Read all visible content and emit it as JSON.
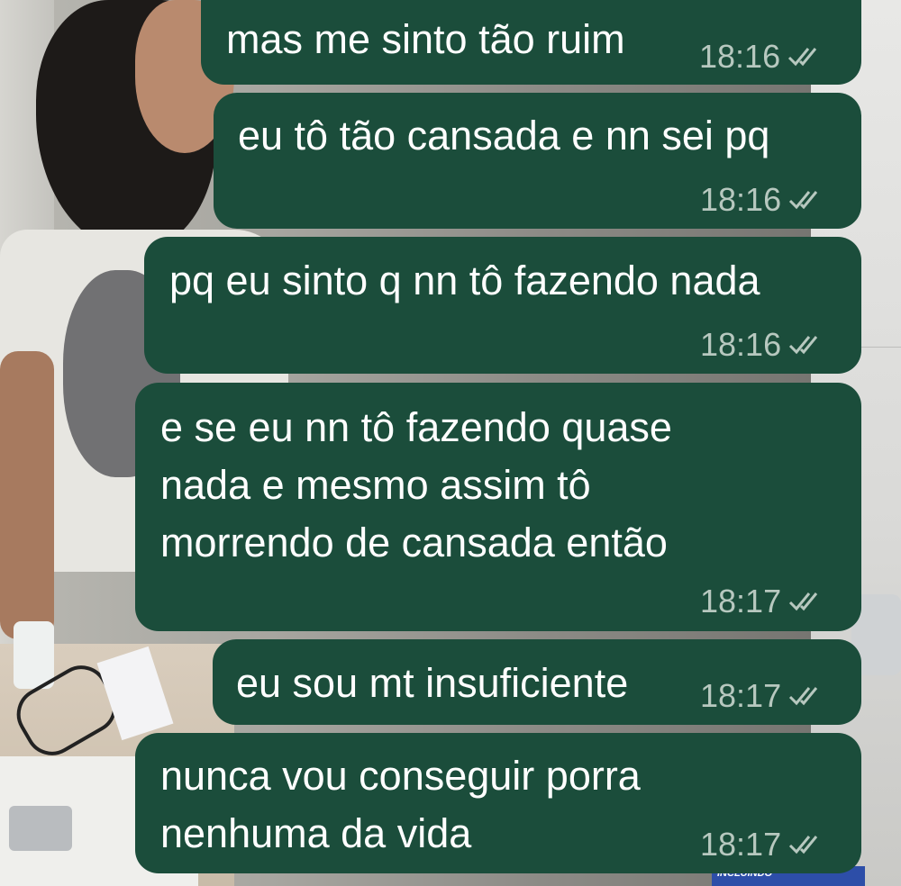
{
  "chat": {
    "messages": [
      {
        "text": "mas me sinto tão ruim",
        "time": "18:16",
        "status_icon": "double-check-icon"
      },
      {
        "text": "eu tô tão cansada e nn sei pq",
        "time": "18:16",
        "status_icon": "double-check-icon"
      },
      {
        "text": "pq eu sinto q nn tô fazendo nada",
        "time": "18:16",
        "status_icon": "double-check-icon"
      },
      {
        "text": "e se eu nn tô fazendo quase\nnada e mesmo assim tô\nmorrendo de cansada então",
        "time": "18:17",
        "status_icon": "double-check-icon"
      },
      {
        "text": "eu sou mt insuficiente",
        "time": "18:17",
        "status_icon": "double-check-icon"
      },
      {
        "text": "nunca vou conseguir porra\nnenhuma da vida",
        "time": "18:17",
        "status_icon": "double-check-icon"
      }
    ]
  },
  "background": {
    "box_text": "INCLUINDO"
  },
  "colors": {
    "bubble": "#1b4d3b",
    "text": "#ffffff",
    "meta": "#b7c8bf"
  }
}
